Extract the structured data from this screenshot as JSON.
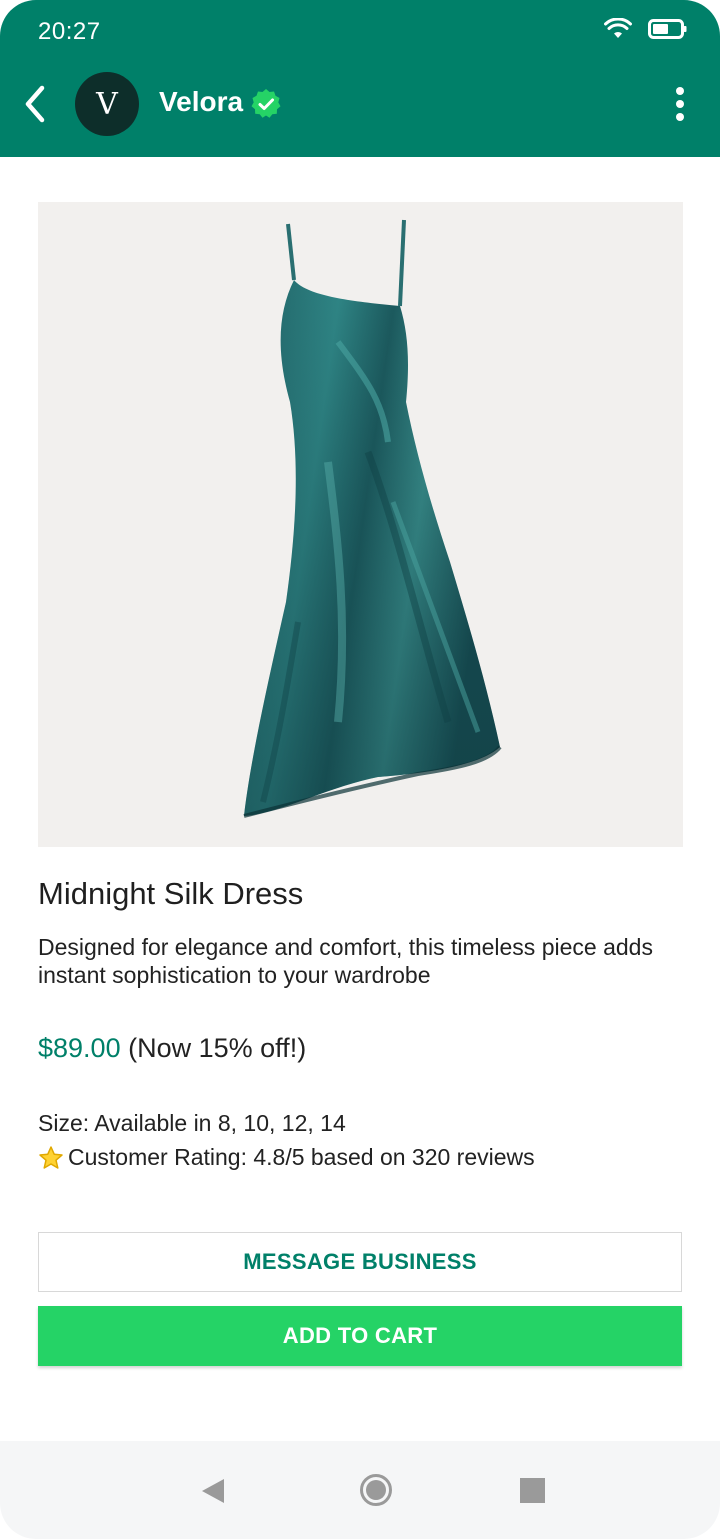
{
  "status_bar": {
    "time": "20:27",
    "icons": [
      "wifi-icon",
      "battery-icon"
    ]
  },
  "header": {
    "avatar_letter": "V",
    "business_name": "Velora",
    "verified": true,
    "back_icon": "back-arrow-icon",
    "menu_icon": "more-vert-icon"
  },
  "product": {
    "image": "teal-silk-slip-dress",
    "title": "Midnight Silk Dress",
    "description": "Designed for elegance and comfort, this timeless piece adds instant sophistication to your wardrobe",
    "price": "$89.00",
    "discount_note": "(Now 15% off!)",
    "size_text": "Size: Available in 8, 10, 12, 14",
    "rating_text": "Customer Rating: 4.8/5 based on 320 reviews"
  },
  "actions": {
    "message_label": "MESSAGE BUSINESS",
    "cart_label": "ADD TO CART"
  },
  "colors": {
    "header_bg": "#008069",
    "accent_green": "#25d366",
    "price_color": "#008069"
  },
  "nav_bar": {
    "icons": [
      "nav-back-icon",
      "nav-home-icon",
      "nav-recents-icon"
    ]
  }
}
